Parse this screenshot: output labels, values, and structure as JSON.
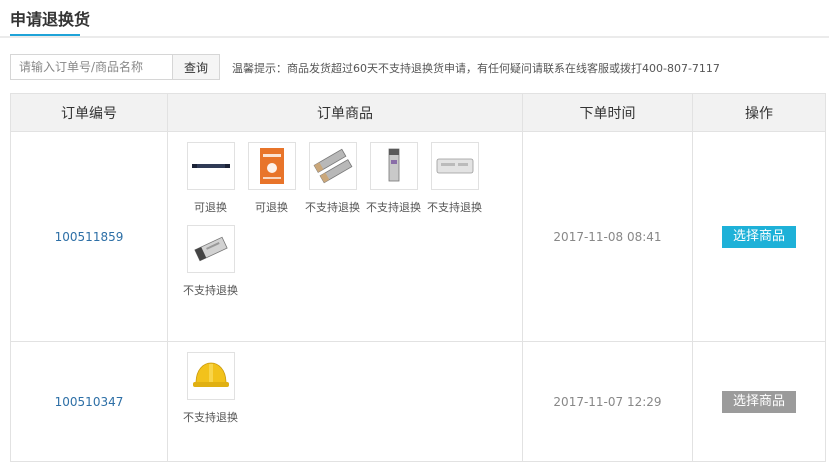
{
  "header": {
    "title": "申请退换货"
  },
  "search": {
    "placeholder": "请输入订单号/商品名称",
    "button_label": "查询"
  },
  "tip": "温馨提示：商品发货超过60天不支持退换货申请，有任何疑问请联系在线客服或拨打400-807-7117",
  "table": {
    "columns": [
      "订单编号",
      "订单商品",
      "下单时间",
      "操作"
    ],
    "rows": [
      {
        "order_id": "100511859",
        "time": "2017-11-08 08:41",
        "action_label": "选择商品",
        "action_enabled": true,
        "items": [
          {
            "icon": "cable-icon",
            "status": "可退换"
          },
          {
            "icon": "product-box-icon",
            "status": "可退换"
          },
          {
            "icon": "transceiver-module-icon",
            "status": "不支持退换"
          },
          {
            "icon": "sfp-module-icon",
            "status": "不支持退换"
          },
          {
            "icon": "power-adapter-icon",
            "status": "不支持退换"
          },
          {
            "icon": "sfp-transceiver-icon",
            "status": "不支持退换"
          }
        ]
      },
      {
        "order_id": "100510347",
        "time": "2017-11-07 12:29",
        "action_label": "选择商品",
        "action_enabled": false,
        "items": [
          {
            "icon": "safety-helmet-icon",
            "status": "不支持退换"
          }
        ]
      }
    ]
  },
  "colors": {
    "accent": "#1fa3d8",
    "button_active": "#1eb1d8",
    "button_disabled": "#9b9b9b",
    "link": "#2d6fa6"
  }
}
